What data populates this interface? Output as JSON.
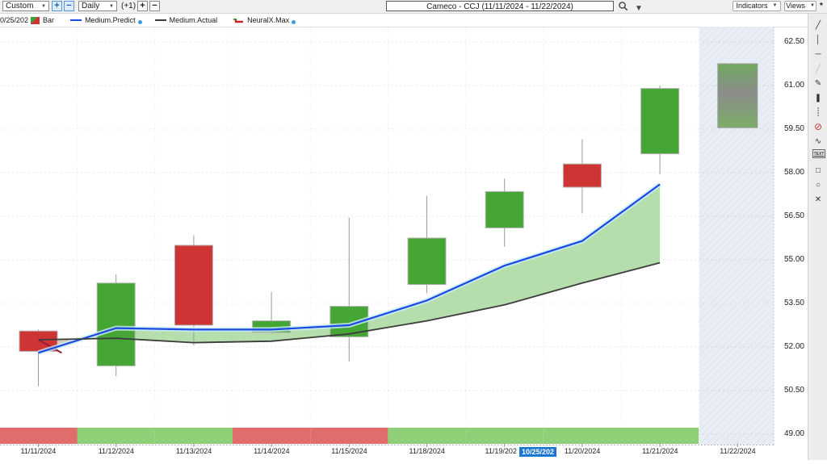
{
  "toolbar": {
    "range_select": "Custom",
    "zoom_in": "+",
    "zoom_out": "−",
    "period_select": "Daily",
    "bar_offset": "(+1)",
    "bars_plus": "+",
    "bars_minus": "−",
    "symbol_title": "Cameco - CCJ (11/11/2024 - 11/22/2024)",
    "indicators_button": "Indicators",
    "views_button": "Views",
    "modified_marker": "*"
  },
  "legend": {
    "clipped_date": "0/25/202",
    "bar_label": "Bar",
    "predict_label": "Medium.Predict",
    "actual_label": "Medium.Actual",
    "neuralx_label": "NeuralX.Max"
  },
  "side_toolbar": {
    "tools": [
      "trend-line",
      "vertical-line",
      "horizontal-line",
      "ray-disabled",
      "pen",
      "marker",
      "dotted-vertical-line",
      "no-draw",
      "wave",
      "text",
      "rectangle",
      "ellipse",
      "erase"
    ]
  },
  "colors": {
    "up_candle": "#45a636",
    "down_candle": "#cf3434",
    "candle_border": "#b2b2b2",
    "wick": "#9b9b9b",
    "predict_line": "#1b49e3",
    "actual_line": "#3c3c3c",
    "neuralx_line": "#8e1f3a",
    "band_fill": "#aedaa4",
    "band_fill_neg": "#c9b8a4",
    "strip_green": "#8fcf78",
    "strip_red": "#e06c6c",
    "future_zone": "#e9eef6",
    "highlight_blue": "#1976d2"
  },
  "chart_data": {
    "type": "candlestick",
    "title": "Cameco - CCJ (11/11/2024 - 11/22/2024)",
    "ylim": [
      49.0,
      62.5
    ],
    "y_ticks": [
      "62.50",
      "61.00",
      "59.50",
      "58.00",
      "56.50",
      "55.00",
      "53.50",
      "52.00",
      "50.50",
      "49.00"
    ],
    "y_tick_values": [
      62.5,
      61.0,
      59.5,
      58.0,
      56.5,
      55.0,
      53.5,
      52.0,
      50.5,
      49.0
    ],
    "grid": true,
    "legend_position": "top-left",
    "dates": [
      "11/11/2024",
      "11/12/2024",
      "11/13/2024",
      "11/14/2024",
      "11/15/2024",
      "11/18/2024",
      "11/19/2024",
      "11/20/2024",
      "11/21/2024",
      "11/22/2024"
    ],
    "candles": [
      {
        "date": "11/11/2024",
        "open": 52.55,
        "high": 52.6,
        "low": 50.65,
        "close": 51.85,
        "dir": "down"
      },
      {
        "date": "11/12/2024",
        "open": 51.35,
        "high": 54.5,
        "low": 51.0,
        "close": 54.2,
        "dir": "up"
      },
      {
        "date": "11/13/2024",
        "open": 55.5,
        "high": 55.85,
        "low": 52.05,
        "close": 52.75,
        "dir": "down"
      },
      {
        "date": "11/14/2024",
        "open": 52.5,
        "high": 53.9,
        "low": 52.45,
        "close": 52.9,
        "dir": "up"
      },
      {
        "date": "11/15/2024",
        "open": 52.35,
        "high": 56.45,
        "low": 51.5,
        "close": 53.4,
        "dir": "up"
      },
      {
        "date": "11/18/2024",
        "open": 54.15,
        "high": 57.2,
        "low": 53.85,
        "close": 55.75,
        "dir": "up"
      },
      {
        "date": "11/19/2024",
        "open": 56.1,
        "high": 57.8,
        "low": 55.45,
        "close": 57.35,
        "dir": "up"
      },
      {
        "date": "11/20/2024",
        "open": 58.3,
        "high": 59.15,
        "low": 56.6,
        "close": 57.5,
        "dir": "down"
      },
      {
        "date": "11/21/2024",
        "open": 58.65,
        "high": 61.0,
        "low": 57.95,
        "close": 60.9,
        "dir": "up"
      }
    ],
    "series": [
      {
        "name": "Medium.Predict",
        "type": "line",
        "color": "#1b49e3",
        "values": [
          51.8,
          52.65,
          52.6,
          52.6,
          52.75,
          53.6,
          54.8,
          55.65,
          57.6
        ]
      },
      {
        "name": "Medium.Actual",
        "type": "line",
        "color": "#3c3c3c",
        "values": [
          52.25,
          52.3,
          52.15,
          52.2,
          52.45,
          52.9,
          53.45,
          54.2,
          54.9
        ]
      }
    ],
    "neuralx_segment": {
      "name": "NeuralX.Max",
      "color": "#8e1f3a",
      "points": [
        [
          0,
          52.25
        ],
        [
          0.3,
          51.8
        ]
      ]
    },
    "prediction_box": {
      "date": "11/22/2024",
      "high": 61.75,
      "low": 59.55
    },
    "future_zone_start_date": "11/22/2024",
    "sentiment_strip": [
      "red",
      "green",
      "green",
      "red",
      "red",
      "green",
      "green",
      "green",
      "green"
    ],
    "x_axis_labels": [
      {
        "text": "11/11/2024"
      },
      {
        "text": "11/12/2024"
      },
      {
        "text": "11/13/2024"
      },
      {
        "text": "11/14/2024"
      },
      {
        "text": "11/15/2024"
      },
      {
        "text": "11/18/2024"
      },
      {
        "text": "11/19/202"
      },
      {
        "text": "10/25/202",
        "highlight": true
      },
      {
        "text": "11/20/2024"
      },
      {
        "text": "11/21/2024"
      },
      {
        "text": "11/22/2024"
      }
    ]
  }
}
